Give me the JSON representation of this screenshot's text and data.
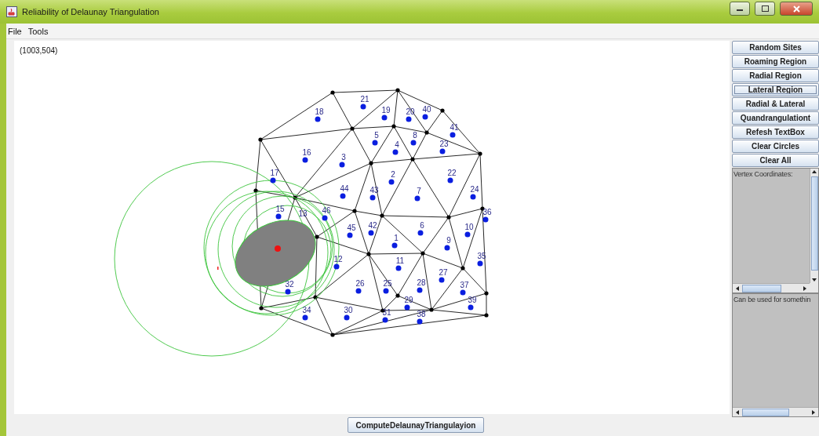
{
  "window": {
    "title": "Reliability of Delaunay Triangulation"
  },
  "menu": [
    "File",
    "Tools"
  ],
  "canvas": {
    "cursor_coordinates": "(1003,504)",
    "sites": [
      {
        "label": "21",
        "kind": "site"
      },
      {
        "label": "18",
        "kind": "site"
      },
      {
        "label": "19",
        "kind": "site"
      },
      {
        "label": "20",
        "kind": "site"
      },
      {
        "label": "40",
        "kind": "site"
      },
      {
        "label": "41",
        "kind": "site"
      },
      {
        "label": "5",
        "kind": "site"
      },
      {
        "label": "8",
        "kind": "site"
      },
      {
        "label": "4",
        "kind": "site"
      },
      {
        "label": "23",
        "kind": "site"
      },
      {
        "label": "16",
        "kind": "site"
      },
      {
        "label": "3",
        "kind": "site"
      },
      {
        "label": "17",
        "kind": "site"
      },
      {
        "label": "2",
        "kind": "site"
      },
      {
        "label": "22",
        "kind": "site"
      },
      {
        "label": "44",
        "kind": "site"
      },
      {
        "label": "43",
        "kind": "site"
      },
      {
        "label": "7",
        "kind": "site"
      },
      {
        "label": "24",
        "kind": "site"
      },
      {
        "label": "15",
        "kind": "site"
      },
      {
        "label": "13",
        "kind": "covered"
      },
      {
        "label": "46",
        "kind": "site"
      },
      {
        "label": "36",
        "kind": "site"
      },
      {
        "label": "45",
        "kind": "site"
      },
      {
        "label": "42",
        "kind": "site"
      },
      {
        "label": "6",
        "kind": "site"
      },
      {
        "label": "10",
        "kind": "site"
      },
      {
        "label": "1",
        "kind": "site"
      },
      {
        "label": "9",
        "kind": "site"
      },
      {
        "label": "12",
        "kind": "site"
      },
      {
        "label": "11",
        "kind": "site"
      },
      {
        "label": "35",
        "kind": "site"
      },
      {
        "label": "27",
        "kind": "site"
      },
      {
        "label": "32",
        "kind": "site"
      },
      {
        "label": "26",
        "kind": "site"
      },
      {
        "label": "25",
        "kind": "site"
      },
      {
        "label": "28",
        "kind": "site"
      },
      {
        "label": "37",
        "kind": "site"
      },
      {
        "label": "29",
        "kind": "site"
      },
      {
        "label": "39",
        "kind": "site"
      },
      {
        "label": "34",
        "kind": "site"
      },
      {
        "label": "30",
        "kind": "site"
      },
      {
        "label": "31",
        "kind": "site"
      },
      {
        "label": "38",
        "kind": "site"
      }
    ]
  },
  "buttons": [
    {
      "label": "Random Sites",
      "focused": false
    },
    {
      "label": "Roaming Region",
      "focused": false
    },
    {
      "label": "Radial Region",
      "focused": false
    },
    {
      "label": "Lateral Region",
      "focused": true
    },
    {
      "label": "Radial & Lateral",
      "focused": false
    },
    {
      "label": "Quandrangulationt",
      "focused": false
    },
    {
      "label": "Refesh TextBox",
      "focused": false
    },
    {
      "label": "Clear Circles",
      "focused": false
    },
    {
      "label": "Clear All",
      "focused": false
    }
  ],
  "text_areas": [
    {
      "text": "Vertex Coordinates:"
    },
    {
      "text": "Can be used for somethin"
    }
  ],
  "bottom_button": {
    "label": "ComputeDelaunayTriangulayion"
  }
}
